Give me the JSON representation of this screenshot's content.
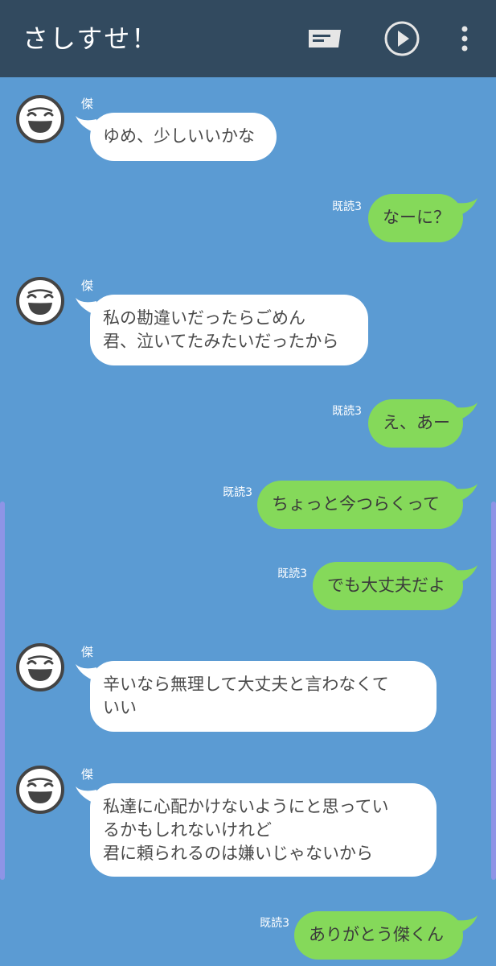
{
  "header": {
    "title": "さしすせ！"
  },
  "colors": {
    "header_bg": "#324a5f",
    "chat_bg": "#5b9bd3",
    "incoming_bubble": "#ffffff",
    "outgoing_bubble": "#85d95a"
  },
  "icons": {
    "header": [
      "message-icon",
      "play-icon",
      "more-vertical-icon"
    ],
    "avatar": "smiling-mask-icon"
  },
  "messages": [
    {
      "direction": "incoming",
      "sender": "傑",
      "lines": [
        "ゆめ、少しいいかな"
      ]
    },
    {
      "direction": "outgoing",
      "read": "既読3",
      "lines": [
        "なーに？"
      ]
    },
    {
      "direction": "incoming",
      "sender": "傑",
      "lines": [
        "私の勘違いだったらごめん",
        "君、泣いてたみたいだったから"
      ]
    },
    {
      "direction": "outgoing",
      "read": "既読3",
      "lines": [
        "え、あー"
      ]
    },
    {
      "direction": "outgoing",
      "read": "既読3",
      "lines": [
        "ちょっと今つらくって"
      ]
    },
    {
      "direction": "outgoing",
      "read": "既読3",
      "lines": [
        "でも大丈夫だよ"
      ]
    },
    {
      "direction": "incoming",
      "sender": "傑",
      "lines": [
        "辛いなら無理して大丈夫と言わなくて",
        "いい"
      ]
    },
    {
      "direction": "incoming",
      "sender": "傑",
      "lines": [
        "私達に心配かけないようにと思ってい",
        "るかもしれないけれど",
        "君に頼られるのは嫌いじゃないから"
      ]
    },
    {
      "direction": "outgoing",
      "read": "既読3",
      "lines": [
        "ありがとう傑くん"
      ]
    }
  ]
}
